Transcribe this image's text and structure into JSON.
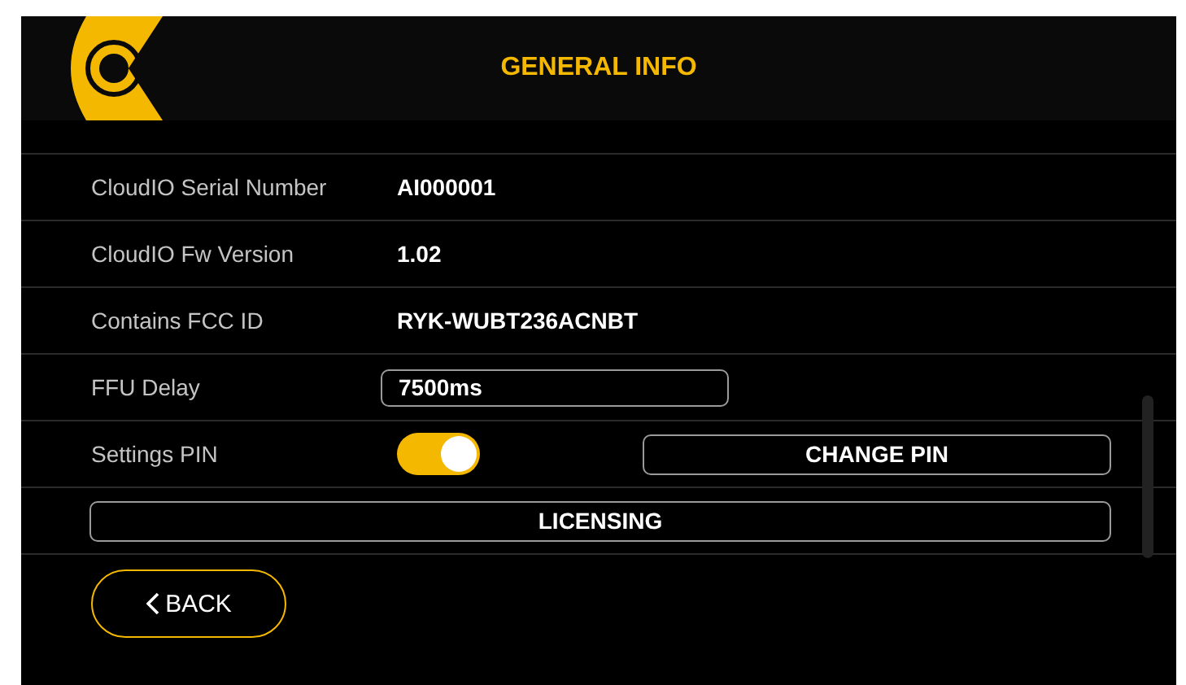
{
  "header": {
    "title": "GENERAL INFO"
  },
  "rows": [
    {
      "kind": "text",
      "label": "CloudIO Serial Number",
      "value": "AI000001"
    },
    {
      "kind": "text",
      "label": "CloudIO Fw Version",
      "value": "1.02"
    },
    {
      "kind": "text",
      "label": "Contains FCC ID",
      "value": "RYK-WUBT236ACNBT"
    },
    {
      "kind": "field",
      "label": "FFU Delay",
      "value": "7500ms"
    },
    {
      "kind": "toggle",
      "label": "Settings PIN",
      "on": true,
      "button": "CHANGE PIN"
    },
    {
      "kind": "button",
      "button": "LICENSING"
    }
  ],
  "back_button": {
    "label": "BACK"
  }
}
